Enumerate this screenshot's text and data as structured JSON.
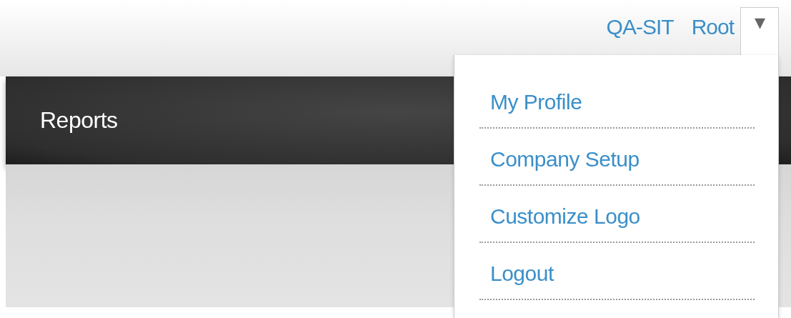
{
  "header": {
    "environment": "QA-SIT",
    "user": "Root",
    "menu_toggle": "▾"
  },
  "nav_bar": {
    "title": "Reports"
  },
  "user_menu": {
    "expanded": true,
    "items": [
      {
        "label": "My Profile"
      },
      {
        "label": "Company Setup"
      },
      {
        "label": "Customize Logo"
      },
      {
        "label": "Logout"
      }
    ]
  }
}
